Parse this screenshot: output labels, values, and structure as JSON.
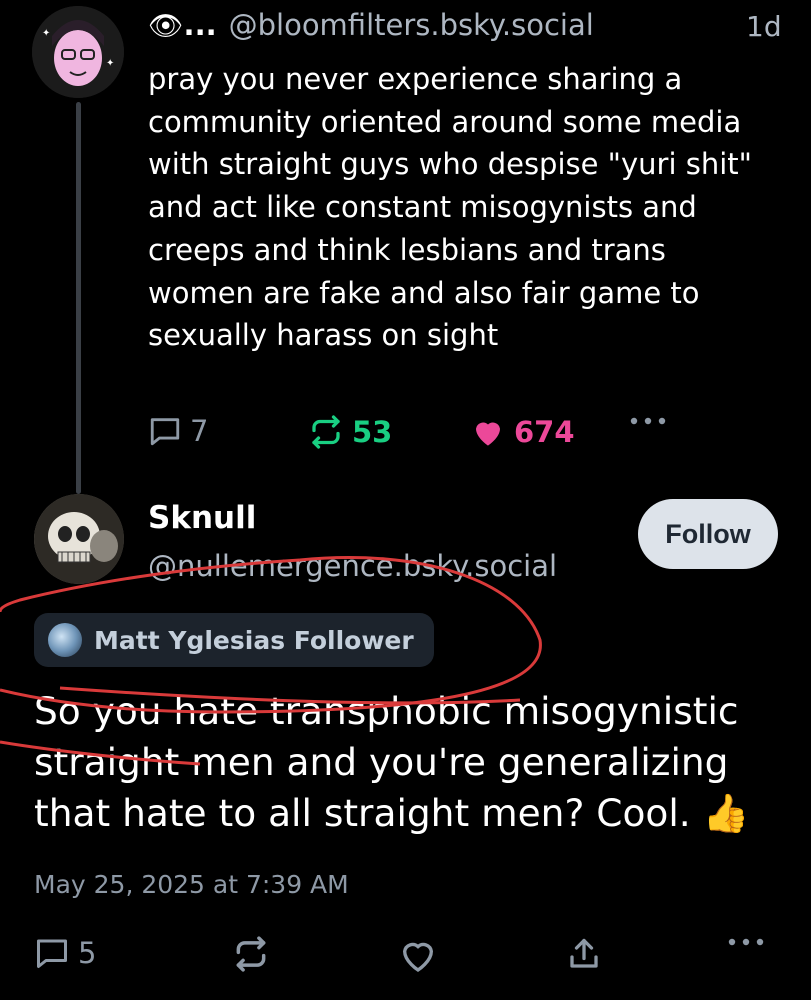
{
  "parent_post": {
    "avatar": "pink-anime-avatar",
    "display_name_emoji": "👁",
    "display_name_trunc": "...",
    "handle": "@bloomfilters.bsky.social",
    "time": "1d",
    "text": "pray you never experience sharing a community oriented around some media with straight guys who despise \"yuri shit\" and act like constant misogynists and creeps and think lesbians and trans women are fake and also fair game to sexually harass on sight",
    "replies": "7",
    "reposts": "53",
    "likes": "674",
    "more_icon": "ellipsis-icon"
  },
  "main_post": {
    "avatar": "skull-avatar",
    "display_name": "Sknull",
    "handle": "@nullemergence.bsky.social",
    "follow_label": "Follow",
    "badge_label": "Matt Yglesias Follower",
    "text": "So you hate transphobic misogynistic straight men and you're generalizing that hate to all straight men?  Cool. 👍",
    "timestamp": "May 25, 2025 at 7:39 AM",
    "replies": "5"
  },
  "colors": {
    "background": "#000000",
    "repost_green": "#19cf82",
    "like_pink": "#ec4899",
    "muted": "#8e99a6",
    "annotation_red": "#d93a3a"
  }
}
